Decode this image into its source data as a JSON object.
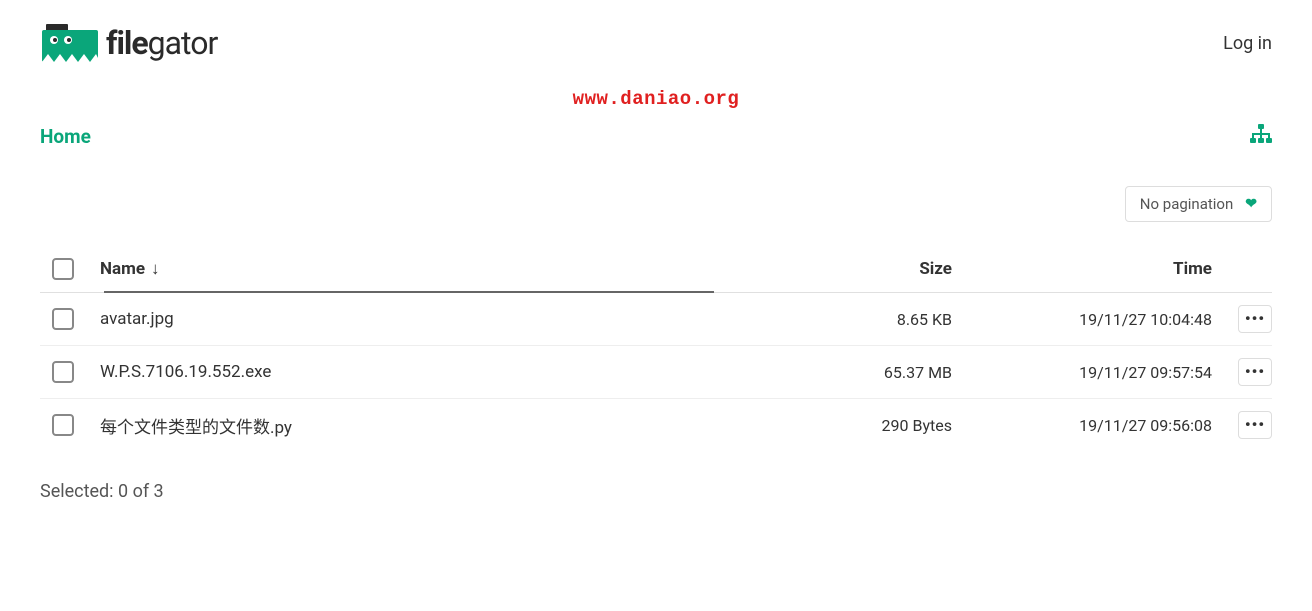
{
  "header": {
    "logo_text_file": "file",
    "logo_text_gator": "gator",
    "login_label": "Log in"
  },
  "watermark": "www.daniao.org",
  "breadcrumb": {
    "home_label": "Home"
  },
  "pagination": {
    "selected_label": "No pagination"
  },
  "table": {
    "columns": {
      "name": "Name",
      "size": "Size",
      "time": "Time"
    },
    "rows": [
      {
        "name": "avatar.jpg",
        "size": "8.65 KB",
        "time": "19/11/27 10:04:48"
      },
      {
        "name": "W.P.S.7106.19.552.exe",
        "size": "65.37 MB",
        "time": "19/11/27 09:57:54"
      },
      {
        "name": "每个文件类型的文件数.py",
        "size": "290 Bytes",
        "time": "19/11/27 09:56:08"
      }
    ]
  },
  "footer": {
    "selected_text": "Selected: 0 of 3"
  },
  "colors": {
    "accent": "#0aa67a",
    "watermark": "#e02020"
  }
}
